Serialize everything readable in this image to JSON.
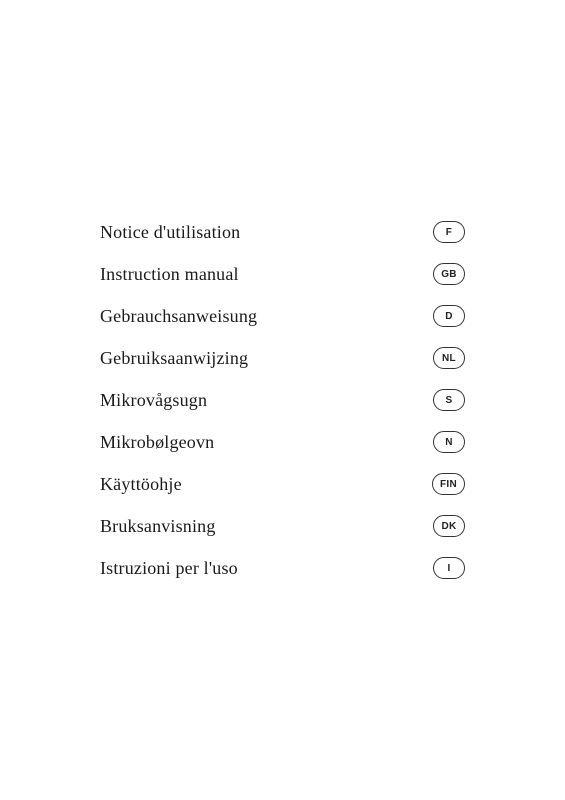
{
  "items": [
    {
      "label": "Notice d'utilisation",
      "badge": "F"
    },
    {
      "label": "Instruction manual",
      "badge": "GB"
    },
    {
      "label": "Gebrauchsanweisung",
      "badge": "D"
    },
    {
      "label": "Gebruiksaanwijzing",
      "badge": "NL"
    },
    {
      "label": "Mikrovågsugn",
      "badge": "S"
    },
    {
      "label": "Mikrobølgeovn",
      "badge": "N"
    },
    {
      "label": "Käyttöohje",
      "badge": "FIN"
    },
    {
      "label": "Bruksanvisning",
      "badge": "DK"
    },
    {
      "label": "Istruzioni per l'uso",
      "badge": "I"
    }
  ]
}
